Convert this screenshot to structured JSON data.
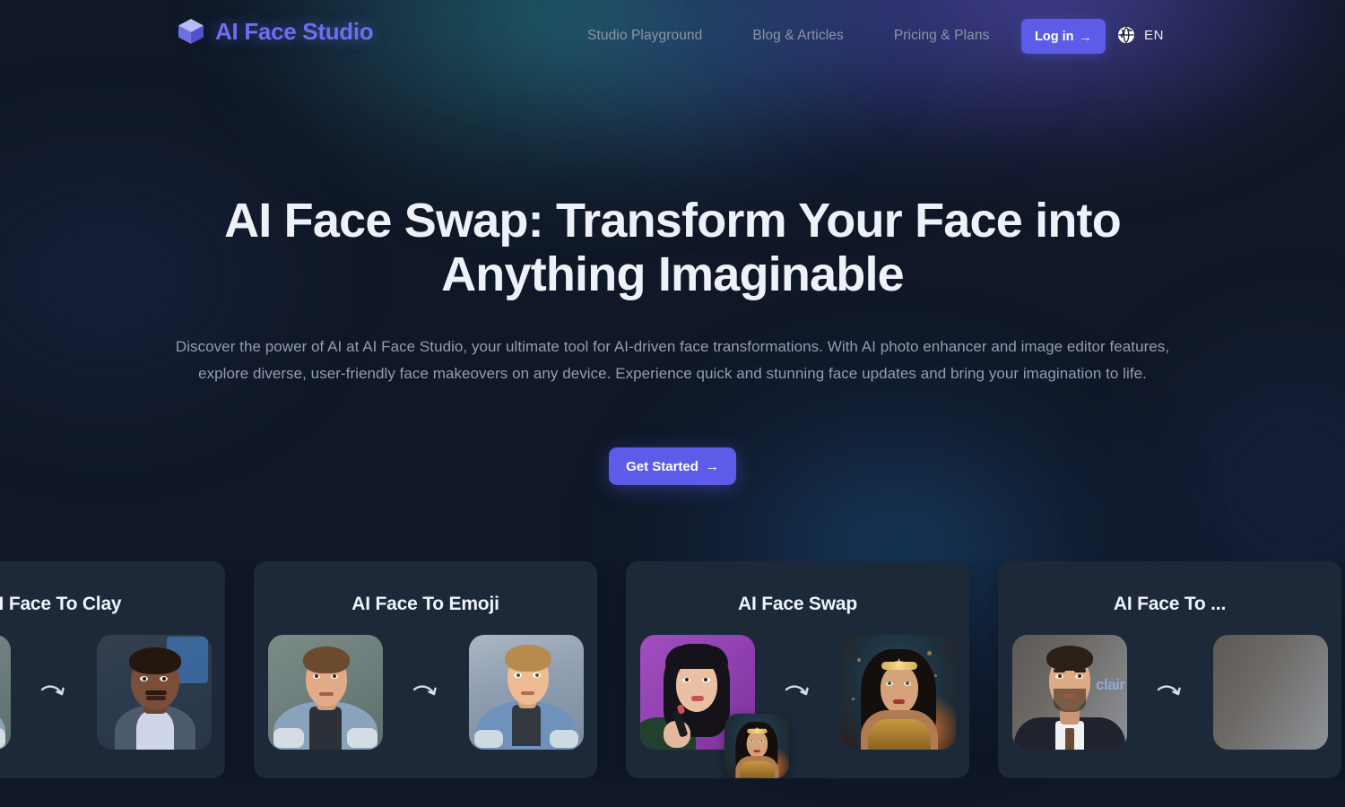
{
  "brand": {
    "name": "AI Face Studio",
    "logo_icon": "cube-icon",
    "logo_color": "#6d6ef0"
  },
  "nav": {
    "links": [
      {
        "label": "Studio Playground"
      },
      {
        "label": "Blog & Articles"
      },
      {
        "label": "Pricing & Plans"
      }
    ],
    "login": {
      "label": "Log in",
      "arrow": "→",
      "color": "#5c5ce8"
    },
    "language": {
      "icon": "globe-icon",
      "code": "EN"
    }
  },
  "hero": {
    "title": "AI Face Swap: Transform Your Face into Anything Imaginable",
    "subtitle": "Discover the power of AI at AI Face Studio, your ultimate tool for AI-driven face transformations. With AI photo enhancer and image editor features, explore diverse, user-friendly face makeovers on any device. Experience quick and stunning face updates and bring your imagination to life.",
    "cta": {
      "label": "Get Started",
      "arrow": "→",
      "color": "#5c5ce8"
    }
  },
  "carousel": {
    "arrow_icon": "curved-arrow-right-icon",
    "cards": [
      {
        "title": "AI Face To Clay",
        "title_truncated": "ace To Clay",
        "before_alt": "photo-of-man",
        "after_alt": "clay-3d-render-of-man",
        "partially_visible": true
      },
      {
        "title": "AI Face To Emoji",
        "before_alt": "photo-of-young-man-in-denim-jacket",
        "after_alt": "3d-emoji-style-render-of-young-man",
        "partially_visible": false
      },
      {
        "title": "AI Face Swap",
        "before_alt": "woman-applying-lipstick-purple-background",
        "before_overlay_alt": "wonder-woman-style-target-face",
        "after_alt": "wonder-woman-style-result",
        "partially_visible": false
      },
      {
        "title": "AI Face To ...",
        "title_truncated": "AI Fa",
        "before_alt": "man-in-suit-on-red-carpet",
        "partially_visible": true
      }
    ]
  },
  "colors": {
    "page_background": "#101827",
    "card_background": "#1d2939",
    "accent": "#5c5ce8",
    "heading_text": "#eef1f8",
    "body_text": "#949cb0",
    "nav_text": "#8d94a6"
  }
}
